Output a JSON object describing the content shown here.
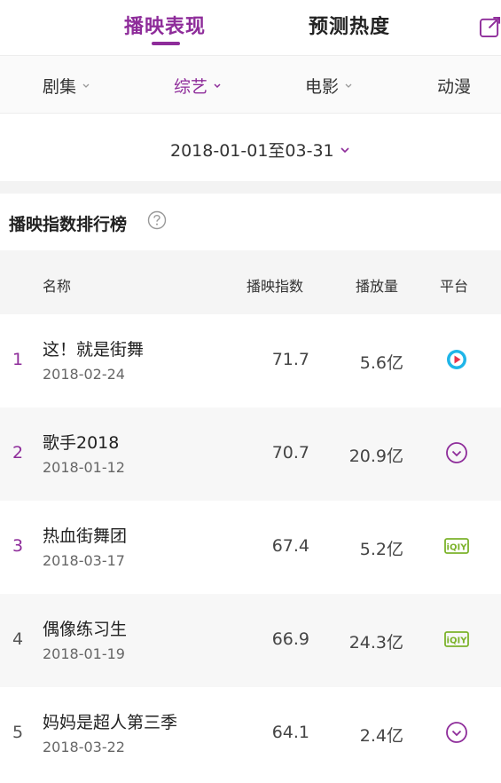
{
  "tabs": [
    {
      "label": "播映表现",
      "active": true
    },
    {
      "label": "预测热度",
      "active": false
    }
  ],
  "categories": [
    {
      "label": "剧集",
      "active": false
    },
    {
      "label": "综艺",
      "active": true
    },
    {
      "label": "电影",
      "active": false
    },
    {
      "label": "动漫",
      "active": false
    }
  ],
  "date_range": "2018-01-01至03-31",
  "section_title": "播映指数排行榜",
  "columns": {
    "name": "名称",
    "index": "播映指数",
    "plays": "播放量",
    "platform": "平台"
  },
  "rows": [
    {
      "rank": "1",
      "title": "这！就是街舞",
      "date": "2018-02-24",
      "index": "71.7",
      "plays": "5.6亿",
      "platform": "youku-icon"
    },
    {
      "rank": "2",
      "title": "歌手2018",
      "date": "2018-01-12",
      "index": "70.7",
      "plays": "20.9亿",
      "platform": "mango-tv-icon"
    },
    {
      "rank": "3",
      "title": "热血街舞团",
      "date": "2018-03-17",
      "index": "67.4",
      "plays": "5.2亿",
      "platform": "iqiyi-icon"
    },
    {
      "rank": "4",
      "title": "偶像练习生",
      "date": "2018-01-19",
      "index": "66.9",
      "plays": "24.3亿",
      "platform": "iqiyi-icon"
    },
    {
      "rank": "5",
      "title": "妈妈是超人第三季",
      "date": "2018-03-22",
      "index": "64.1",
      "plays": "2.4亿",
      "platform": "mango-tv-icon"
    }
  ],
  "colors": {
    "accent": "#8e2c9a",
    "iqiyi": "#7cb32b",
    "youku": "#1fb5e8"
  }
}
